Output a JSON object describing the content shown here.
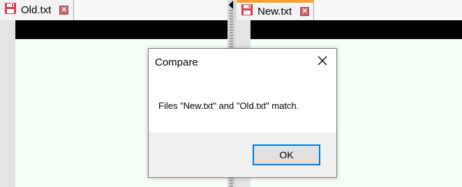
{
  "left_pane": {
    "tab": {
      "label": "Old.txt",
      "icon": "save-file-icon",
      "close_icon": "close-icon"
    }
  },
  "right_pane": {
    "tab": {
      "label": "New.txt",
      "icon": "save-file-icon",
      "close_icon": "close-icon",
      "accent": "#f2a33a"
    }
  },
  "dialog": {
    "title": "Compare",
    "message": "Files \"New.txt\" and \"Old.txt\" match.",
    "ok_label": "OK",
    "accent": "#0078d7"
  },
  "colors": {
    "content_background": "#f5fff5",
    "tab_icon": "#d0404a"
  }
}
